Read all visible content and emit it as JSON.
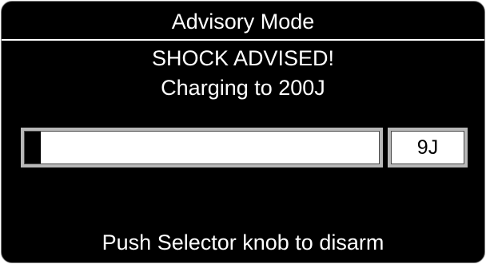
{
  "header": {
    "title": "Advisory Mode"
  },
  "status": {
    "advisory": "SHOCK ADVISED!",
    "charging": "Charging to 200J"
  },
  "charge": {
    "current_label": "9J",
    "current_joules": 9,
    "target_joules": 200
  },
  "footer": {
    "instruction": "Push Selector knob to disarm"
  },
  "colors": {
    "background": "#000000",
    "text": "#ffffff",
    "bar_track": "#ffffff",
    "bar_fill": "#000000",
    "bar_bezel": "#b8b8b8"
  }
}
